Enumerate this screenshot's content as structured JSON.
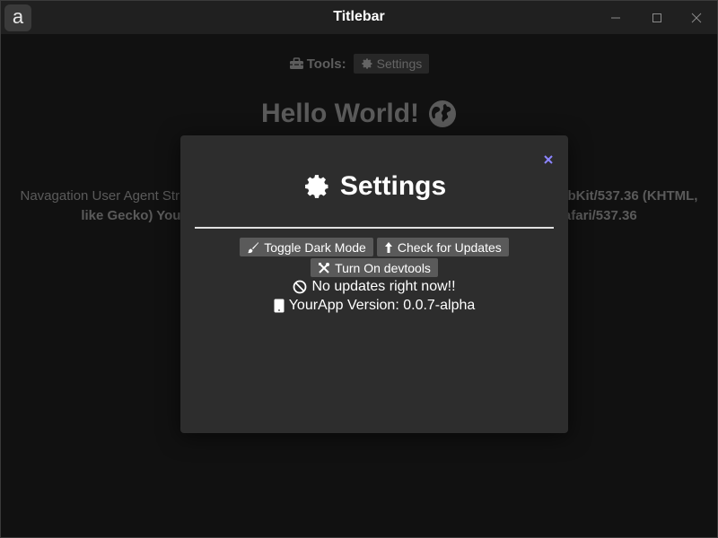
{
  "titlebar": {
    "logo": "a",
    "title": "Titlebar",
    "icons": [
      "minimize-icon",
      "maximize-icon",
      "close-icon"
    ]
  },
  "page": {
    "tools_label": "Tools:",
    "settings_chip_label": "Settings",
    "hello_text": "Hello World!",
    "ua_prefix": "Navagation User Agent Str",
    "ua_part_a": "bKit/537.36 (KHTML,",
    "ua_part_b": "like Gecko) YourA",
    "ua_part_c": "Safari/537.36"
  },
  "modal": {
    "title": "Settings",
    "buttons": {
      "toggle_dark": "Toggle Dark Mode",
      "check_updates": "Check for Updates",
      "devtools": "Turn On devtools"
    },
    "status": "No updates right now!!",
    "version": "YourApp Version: 0.0.7-alpha"
  },
  "colors": {
    "background": "#1b1b1b",
    "modal_bg": "#2d2d2d",
    "button_bg": "#5a5a5a",
    "close_accent": "#8c85ff"
  }
}
